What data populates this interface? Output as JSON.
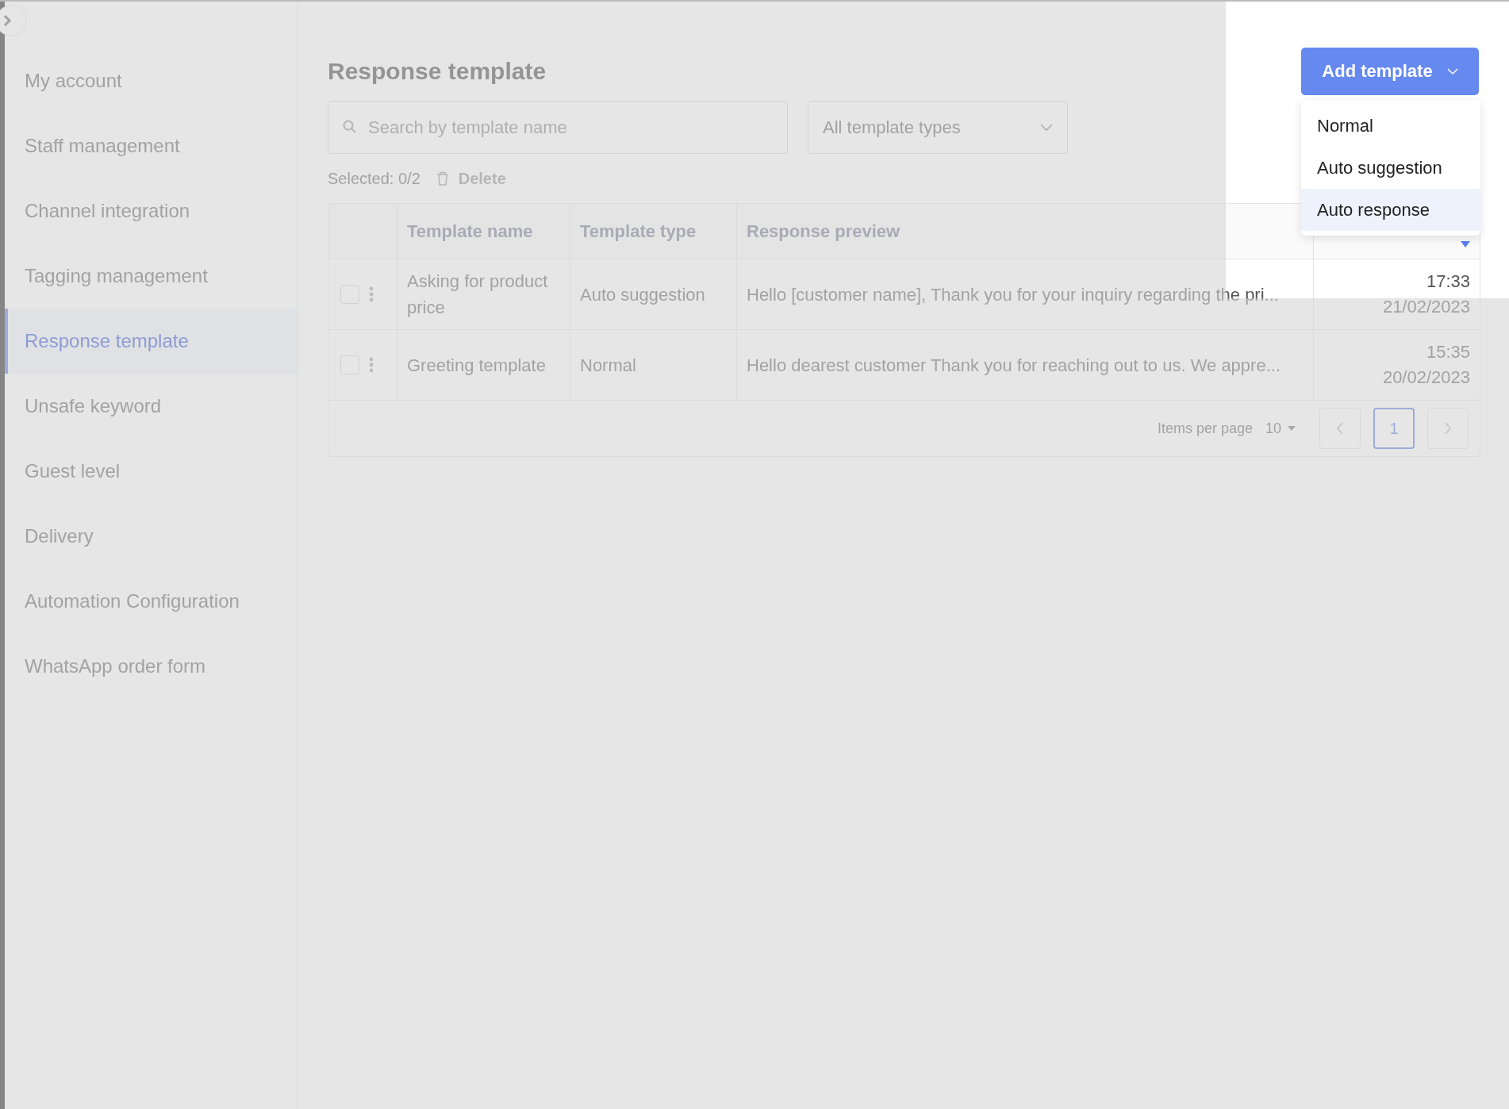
{
  "sidebar": {
    "items": [
      {
        "label": "My account",
        "selected": false
      },
      {
        "label": "Staff management",
        "selected": false
      },
      {
        "label": "Channel integration",
        "selected": false
      },
      {
        "label": "Tagging management",
        "selected": false
      },
      {
        "label": "Response template",
        "selected": true
      },
      {
        "label": "Unsafe keyword",
        "selected": false
      },
      {
        "label": "Guest level",
        "selected": false
      },
      {
        "label": "Delivery",
        "selected": false
      },
      {
        "label": "Automation Configuration",
        "selected": false
      },
      {
        "label": "WhatsApp order form",
        "selected": false
      }
    ]
  },
  "page": {
    "title": "Response template"
  },
  "add_button": {
    "label": "Add template",
    "expanded": true
  },
  "add_menu": {
    "items": [
      {
        "label": "Normal",
        "selected": false
      },
      {
        "label": "Auto suggestion",
        "selected": false
      },
      {
        "label": "Auto response",
        "selected": true
      }
    ]
  },
  "search": {
    "placeholder": "Search by template name"
  },
  "type_filter": {
    "value": "All template types"
  },
  "selection": {
    "text": "Selected: 0/2",
    "delete_label": "Delete",
    "delete_disabled": true
  },
  "table": {
    "columns": [
      "Template name",
      "Template type",
      "Response preview"
    ],
    "rows": [
      {
        "checked": false,
        "name": "Asking for product price",
        "type": "Auto suggestion",
        "preview": "Hello [customer name], Thank you for your inquiry regarding the pri...",
        "time": "17:33",
        "date": "21/02/2023"
      },
      {
        "checked": false,
        "name": "Greeting template",
        "type": "Normal",
        "preview": "Hello dearest customer Thank you for reaching out to us. We appre...",
        "time": "15:35",
        "date": "20/02/2023"
      }
    ]
  },
  "pagination": {
    "label": "Items per page",
    "per_page": "10",
    "pages": [
      {
        "label": "1",
        "selected": true
      }
    ]
  }
}
